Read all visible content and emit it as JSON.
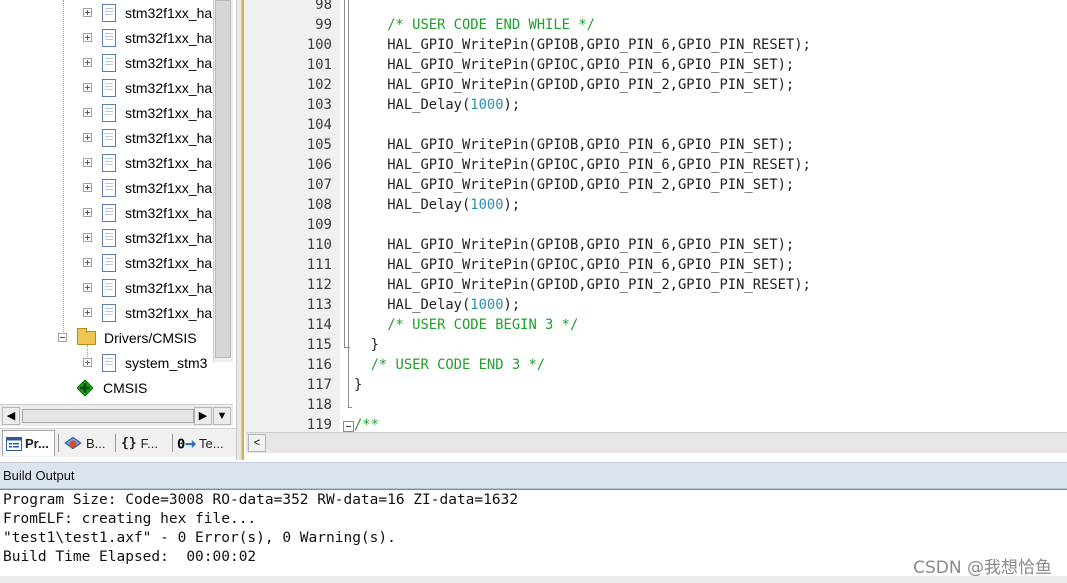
{
  "project_tree": {
    "items": [
      {
        "type": "file",
        "label": "stm32f1xx_ha",
        "expander": "plus"
      },
      {
        "type": "file",
        "label": "stm32f1xx_ha",
        "expander": "plus"
      },
      {
        "type": "file",
        "label": "stm32f1xx_ha",
        "expander": "plus"
      },
      {
        "type": "file",
        "label": "stm32f1xx_ha",
        "expander": "plus"
      },
      {
        "type": "file",
        "label": "stm32f1xx_ha",
        "expander": "plus"
      },
      {
        "type": "file",
        "label": "stm32f1xx_ha",
        "expander": "plus"
      },
      {
        "type": "file",
        "label": "stm32f1xx_ha",
        "expander": "plus"
      },
      {
        "type": "file",
        "label": "stm32f1xx_ha",
        "expander": "plus"
      },
      {
        "type": "file",
        "label": "stm32f1xx_ha",
        "expander": "plus"
      },
      {
        "type": "file",
        "label": "stm32f1xx_ha",
        "expander": "plus"
      },
      {
        "type": "file",
        "label": "stm32f1xx_ha",
        "expander": "plus"
      },
      {
        "type": "file",
        "label": "stm32f1xx_ha",
        "expander": "plus"
      },
      {
        "type": "file",
        "label": "stm32f1xx_ha",
        "expander": "plus"
      },
      {
        "type": "folder",
        "label": "Drivers/CMSIS",
        "expander": "minus"
      },
      {
        "type": "file",
        "label": "system_stm3",
        "expander": "plus"
      },
      {
        "type": "component",
        "label": "CMSIS",
        "expander": "none"
      }
    ]
  },
  "tabs": [
    {
      "label": "Pr...",
      "icon": "project-icon",
      "active": true
    },
    {
      "label": "B...",
      "icon": "books-icon",
      "active": false
    },
    {
      "label": "F...",
      "icon": "functions-icon",
      "active": false
    },
    {
      "label": "Te...",
      "icon": "templates-icon",
      "active": false
    }
  ],
  "scroll_buttons": {
    "left": "◀",
    "right": "▶",
    "down": "▼",
    "editor_left": "<"
  },
  "editor": {
    "lines": [
      {
        "n": "98",
        "parts": []
      },
      {
        "n": "99",
        "parts": [
          [
            "t",
            "    "
          ],
          [
            "cm",
            "/* USER CODE END WHILE */"
          ]
        ]
      },
      {
        "n": "100",
        "parts": [
          [
            "t",
            "    HAL_GPIO_WritePin(GPIOB,GPIO_PIN_6,GPIO_PIN_RESET);"
          ]
        ]
      },
      {
        "n": "101",
        "parts": [
          [
            "t",
            "    HAL_GPIO_WritePin(GPIOC,GPIO_PIN_6,GPIO_PIN_SET);"
          ]
        ]
      },
      {
        "n": "102",
        "parts": [
          [
            "t",
            "    HAL_GPIO_WritePin(GPIOD,GPIO_PIN_2,GPIO_PIN_SET);"
          ]
        ]
      },
      {
        "n": "103",
        "parts": [
          [
            "t",
            "    HAL_Delay("
          ],
          [
            "num",
            "1000"
          ],
          [
            "t",
            ");"
          ]
        ]
      },
      {
        "n": "104",
        "parts": []
      },
      {
        "n": "105",
        "parts": [
          [
            "t",
            "    HAL_GPIO_WritePin(GPIOB,GPIO_PIN_6,GPIO_PIN_SET);"
          ]
        ]
      },
      {
        "n": "106",
        "parts": [
          [
            "t",
            "    HAL_GPIO_WritePin(GPIOC,GPIO_PIN_6,GPIO_PIN_RESET);"
          ]
        ]
      },
      {
        "n": "107",
        "parts": [
          [
            "t",
            "    HAL_GPIO_WritePin(GPIOD,GPIO_PIN_2,GPIO_PIN_SET);"
          ]
        ]
      },
      {
        "n": "108",
        "parts": [
          [
            "t",
            "    HAL_Delay("
          ],
          [
            "num",
            "1000"
          ],
          [
            "t",
            ");"
          ]
        ]
      },
      {
        "n": "109",
        "parts": []
      },
      {
        "n": "110",
        "parts": [
          [
            "t",
            "    HAL_GPIO_WritePin(GPIOB,GPIO_PIN_6,GPIO_PIN_SET);"
          ]
        ]
      },
      {
        "n": "111",
        "parts": [
          [
            "t",
            "    HAL_GPIO_WritePin(GPIOC,GPIO_PIN_6,GPIO_PIN_SET);"
          ]
        ]
      },
      {
        "n": "112",
        "parts": [
          [
            "t",
            "    HAL_GPIO_WritePin(GPIOD,GPIO_PIN_2,GPIO_PIN_RESET);"
          ]
        ]
      },
      {
        "n": "113",
        "parts": [
          [
            "t",
            "    HAL_Delay("
          ],
          [
            "num",
            "1000"
          ],
          [
            "t",
            ");"
          ]
        ]
      },
      {
        "n": "114",
        "parts": [
          [
            "t",
            "    "
          ],
          [
            "cm",
            "/* USER CODE BEGIN 3 */"
          ]
        ]
      },
      {
        "n": "115",
        "parts": [
          [
            "t",
            "  }"
          ]
        ]
      },
      {
        "n": "116",
        "parts": [
          [
            "t",
            "  "
          ],
          [
            "cm",
            "/* USER CODE END 3 */"
          ]
        ]
      },
      {
        "n": "117",
        "parts": [
          [
            "t",
            "}"
          ]
        ]
      },
      {
        "n": "118",
        "parts": []
      },
      {
        "n": "119",
        "parts": [
          [
            "cm",
            "/**"
          ]
        ]
      }
    ]
  },
  "build_output": {
    "title": "Build Output",
    "lines": [
      "Program Size: Code=3008 RO-data=352 RW-data=16 ZI-data=1632",
      "FromELF: creating hex file...",
      "\"test1\\test1.axf\" - 0 Error(s), 0 Warning(s).",
      "Build Time Elapsed:  00:00:02"
    ]
  },
  "watermark": "CSDN @我想恰鱼",
  "colors": {
    "comment": "#1f9f2c",
    "number": "#2c8fb0",
    "build_header_bg": "#dce4ef",
    "gutter_bg": "#f0f0f0"
  }
}
